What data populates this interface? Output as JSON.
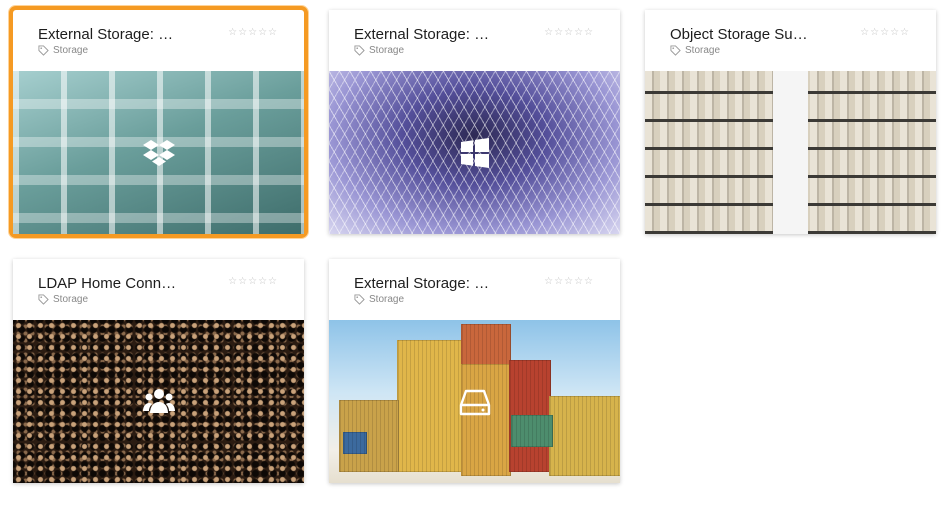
{
  "tag_label": "Storage",
  "rating_stars": "☆☆☆☆☆",
  "cards": [
    {
      "title": "External Storage: …",
      "icon": "dropbox-icon",
      "selected": true
    },
    {
      "title": "External Storage: …",
      "icon": "windows-icon"
    },
    {
      "title": "Object Storage Su…",
      "icon": "none"
    },
    {
      "title": "LDAP Home Conn…",
      "icon": "users-icon"
    },
    {
      "title": "External Storage: …",
      "icon": "drive-icon"
    }
  ],
  "colors": {
    "selection": "#f59a23",
    "tag_text": "#888888",
    "star": "#c4c4c4"
  }
}
